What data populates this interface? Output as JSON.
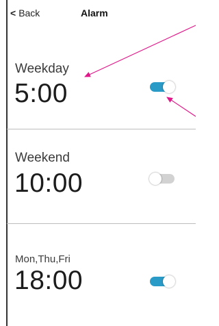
{
  "nav": {
    "back_label": "Back",
    "title": "Alarm"
  },
  "alarms": [
    {
      "label": "Weekday",
      "time": "5:00",
      "enabled": true
    },
    {
      "label": "Weekend",
      "time": "10:00",
      "enabled": false
    },
    {
      "label": "Mon,Thu,Fri",
      "time": "18:00",
      "enabled": true
    }
  ],
  "colors": {
    "toggle_on": "#2a9ac7",
    "toggle_off": "#d2d2d2",
    "annotation_arrow": "#e0198a"
  }
}
